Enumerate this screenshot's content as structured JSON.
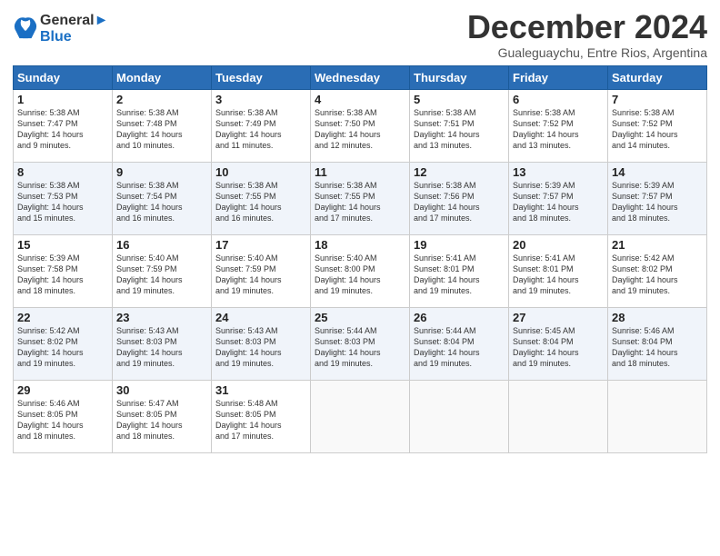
{
  "header": {
    "logo_line1": "General",
    "logo_line2": "Blue",
    "month_title": "December 2024",
    "subtitle": "Gualeguaychu, Entre Rios, Argentina"
  },
  "days_of_week": [
    "Sunday",
    "Monday",
    "Tuesday",
    "Wednesday",
    "Thursday",
    "Friday",
    "Saturday"
  ],
  "weeks": [
    [
      {
        "day": "1",
        "sunrise": "5:38 AM",
        "sunset": "7:47 PM",
        "daylight": "14 hours and 9 minutes."
      },
      {
        "day": "2",
        "sunrise": "5:38 AM",
        "sunset": "7:48 PM",
        "daylight": "14 hours and 10 minutes."
      },
      {
        "day": "3",
        "sunrise": "5:38 AM",
        "sunset": "7:49 PM",
        "daylight": "14 hours and 11 minutes."
      },
      {
        "day": "4",
        "sunrise": "5:38 AM",
        "sunset": "7:50 PM",
        "daylight": "14 hours and 12 minutes."
      },
      {
        "day": "5",
        "sunrise": "5:38 AM",
        "sunset": "7:51 PM",
        "daylight": "14 hours and 13 minutes."
      },
      {
        "day": "6",
        "sunrise": "5:38 AM",
        "sunset": "7:52 PM",
        "daylight": "14 hours and 13 minutes."
      },
      {
        "day": "7",
        "sunrise": "5:38 AM",
        "sunset": "7:52 PM",
        "daylight": "14 hours and 14 minutes."
      }
    ],
    [
      {
        "day": "8",
        "sunrise": "5:38 AM",
        "sunset": "7:53 PM",
        "daylight": "14 hours and 15 minutes."
      },
      {
        "day": "9",
        "sunrise": "5:38 AM",
        "sunset": "7:54 PM",
        "daylight": "14 hours and 16 minutes."
      },
      {
        "day": "10",
        "sunrise": "5:38 AM",
        "sunset": "7:55 PM",
        "daylight": "14 hours and 16 minutes."
      },
      {
        "day": "11",
        "sunrise": "5:38 AM",
        "sunset": "7:55 PM",
        "daylight": "14 hours and 17 minutes."
      },
      {
        "day": "12",
        "sunrise": "5:38 AM",
        "sunset": "7:56 PM",
        "daylight": "14 hours and 17 minutes."
      },
      {
        "day": "13",
        "sunrise": "5:39 AM",
        "sunset": "7:57 PM",
        "daylight": "14 hours and 18 minutes."
      },
      {
        "day": "14",
        "sunrise": "5:39 AM",
        "sunset": "7:57 PM",
        "daylight": "14 hours and 18 minutes."
      }
    ],
    [
      {
        "day": "15",
        "sunrise": "5:39 AM",
        "sunset": "7:58 PM",
        "daylight": "14 hours and 18 minutes."
      },
      {
        "day": "16",
        "sunrise": "5:40 AM",
        "sunset": "7:59 PM",
        "daylight": "14 hours and 19 minutes."
      },
      {
        "day": "17",
        "sunrise": "5:40 AM",
        "sunset": "7:59 PM",
        "daylight": "14 hours and 19 minutes."
      },
      {
        "day": "18",
        "sunrise": "5:40 AM",
        "sunset": "8:00 PM",
        "daylight": "14 hours and 19 minutes."
      },
      {
        "day": "19",
        "sunrise": "5:41 AM",
        "sunset": "8:01 PM",
        "daylight": "14 hours and 19 minutes."
      },
      {
        "day": "20",
        "sunrise": "5:41 AM",
        "sunset": "8:01 PM",
        "daylight": "14 hours and 19 minutes."
      },
      {
        "day": "21",
        "sunrise": "5:42 AM",
        "sunset": "8:02 PM",
        "daylight": "14 hours and 19 minutes."
      }
    ],
    [
      {
        "day": "22",
        "sunrise": "5:42 AM",
        "sunset": "8:02 PM",
        "daylight": "14 hours and 19 minutes."
      },
      {
        "day": "23",
        "sunrise": "5:43 AM",
        "sunset": "8:03 PM",
        "daylight": "14 hours and 19 minutes."
      },
      {
        "day": "24",
        "sunrise": "5:43 AM",
        "sunset": "8:03 PM",
        "daylight": "14 hours and 19 minutes."
      },
      {
        "day": "25",
        "sunrise": "5:44 AM",
        "sunset": "8:03 PM",
        "daylight": "14 hours and 19 minutes."
      },
      {
        "day": "26",
        "sunrise": "5:44 AM",
        "sunset": "8:04 PM",
        "daylight": "14 hours and 19 minutes."
      },
      {
        "day": "27",
        "sunrise": "5:45 AM",
        "sunset": "8:04 PM",
        "daylight": "14 hours and 19 minutes."
      },
      {
        "day": "28",
        "sunrise": "5:46 AM",
        "sunset": "8:04 PM",
        "daylight": "14 hours and 18 minutes."
      }
    ],
    [
      {
        "day": "29",
        "sunrise": "5:46 AM",
        "sunset": "8:05 PM",
        "daylight": "14 hours and 18 minutes."
      },
      {
        "day": "30",
        "sunrise": "5:47 AM",
        "sunset": "8:05 PM",
        "daylight": "14 hours and 18 minutes."
      },
      {
        "day": "31",
        "sunrise": "5:48 AM",
        "sunset": "8:05 PM",
        "daylight": "14 hours and 17 minutes."
      },
      null,
      null,
      null,
      null
    ]
  ],
  "labels": {
    "sunrise": "Sunrise:",
    "sunset": "Sunset:",
    "daylight": "Daylight:"
  }
}
